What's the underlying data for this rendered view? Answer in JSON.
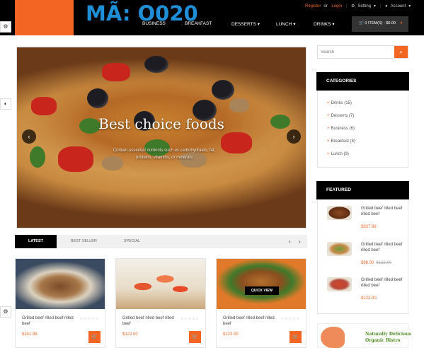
{
  "header": {
    "code_title": "MÃ: O020",
    "top_links": {
      "register": "Register",
      "or": "or",
      "login": "Login",
      "setting": "Setting",
      "account": "Account"
    },
    "nav": [
      {
        "label": "BUSINESS"
      },
      {
        "label": "BREAKFAST"
      },
      {
        "label": "DESSERTS"
      },
      {
        "label": "LUNCH"
      },
      {
        "label": "DRINKS"
      }
    ],
    "cart_label": "0 ITEM(S) - $0.00"
  },
  "slider": {
    "caption": "Best choice foods",
    "subtitle": "Contain essential nutrients such as carbohydrates, fat, proteins, vitamins, or minerals",
    "prev": "‹",
    "next": "›"
  },
  "search": {
    "placeholder": "Search",
    "button_icon": "search-icon"
  },
  "categories": {
    "title": "CATEGORIES",
    "items": [
      {
        "label": "Drinks",
        "count": "(15)"
      },
      {
        "label": "Desserts",
        "count": "(7)"
      },
      {
        "label": "Business",
        "count": "(6)"
      },
      {
        "label": "Breakfast",
        "count": "(8)"
      },
      {
        "label": "Lunch",
        "count": "(9)"
      }
    ]
  },
  "featured": {
    "title": "FEATURED",
    "items": [
      {
        "name": "Grilled beef rilled beef rilled beef",
        "price": "$337.99",
        "old_price": ""
      },
      {
        "name": "Grilled beef rilled beef rilled beef",
        "price": "$98.00",
        "old_price": "$122.00"
      },
      {
        "name": "Grilled beef rilled beef rilled beef",
        "price": "$122.00",
        "old_price": ""
      }
    ]
  },
  "tabs": {
    "items": [
      {
        "label": "LATEST",
        "active": true
      },
      {
        "label": "BEST SELLER",
        "active": false
      },
      {
        "label": "SPECIAL",
        "active": false
      }
    ],
    "prev": "‹",
    "next": "›"
  },
  "products": [
    {
      "name": "Grilled beef rilled beef rilled beef",
      "price": "$241.99"
    },
    {
      "name": "Grilled beef rilled beef rilled beef",
      "price": "$122.00"
    },
    {
      "name": "Grilled beef rilled beef rilled beef",
      "price": "$122.00",
      "quick_view": "QUICK VIEW"
    }
  ],
  "banner": {
    "line1": "Naturally Delicious",
    "line2": "Organic Bistro"
  },
  "colors": {
    "accent": "#f26522",
    "title_blue": "#1e8fd6",
    "header_bg": "#000000"
  }
}
